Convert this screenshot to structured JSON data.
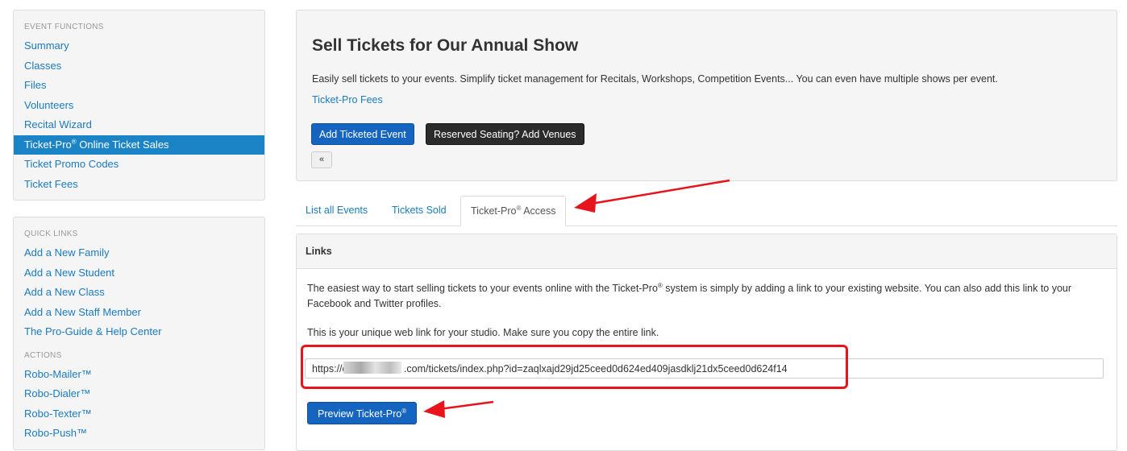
{
  "sidebar": {
    "functions_label": "EVENT FUNCTIONS",
    "functions": [
      {
        "label": "Summary"
      },
      {
        "label": "Classes"
      },
      {
        "label": "Files"
      },
      {
        "label": "Volunteers"
      },
      {
        "label": "Recital Wizard"
      },
      {
        "label": "Ticket-Pro",
        "sup": "®",
        "suffix": " Online Ticket Sales",
        "active": true
      },
      {
        "label": "Ticket Promo Codes"
      },
      {
        "label": "Ticket Fees"
      }
    ],
    "quick_links_label": "QUICK LINKS",
    "quick_links": [
      {
        "label": "Add a New Family"
      },
      {
        "label": "Add a New Student"
      },
      {
        "label": "Add a New Class"
      },
      {
        "label": "Add a New Staff Member"
      },
      {
        "label": "The Pro-Guide & Help Center"
      }
    ],
    "actions_label": "ACTIONS",
    "actions": [
      {
        "label": "Robo-Mailer™"
      },
      {
        "label": "Robo-Dialer™"
      },
      {
        "label": "Robo-Texter™"
      },
      {
        "label": "Robo-Push™"
      }
    ]
  },
  "header": {
    "title": "Sell Tickets for Our Annual Show",
    "description": "Easily sell tickets to your events. Simplify ticket management for Recitals, Workshops, Competition Events... You can even have multiple shows per event.",
    "fees_link": "Ticket-Pro Fees",
    "add_event_label": "Add Ticketed Event",
    "venues_label": "Reserved Seating? Add Venues",
    "back_icon": "«"
  },
  "tabs": {
    "list_all": "List all Events",
    "sold": "Tickets Sold",
    "access_prefix": "Ticket-Pro",
    "access_sup": "®",
    "access_suffix": " Access"
  },
  "links": {
    "heading": "Links",
    "intro_a": "The easiest way to start selling tickets to your events online with the Ticket-Pro",
    "intro_sup": "®",
    "intro_b": " system is simply by adding a link to your existing website. You can also add this link to your Facebook and Twitter profiles.",
    "unique_text": "This is your unique web link for your studio. Make sure you copy the entire link.",
    "url_value": "https://d                    .com/tickets/index.php?id=zaqlxajd29jd25ceed0d624ed409jasdklj21dx5ceed0d624f14",
    "preview_prefix": "Preview Ticket-Pro",
    "preview_sup": "®"
  },
  "colors": {
    "link": "#1a7bbf",
    "active_bg": "#1a84c7",
    "primary_button": "#1565c0",
    "dark_button": "#2b2b2b",
    "annotation_red": "#e8141c"
  }
}
